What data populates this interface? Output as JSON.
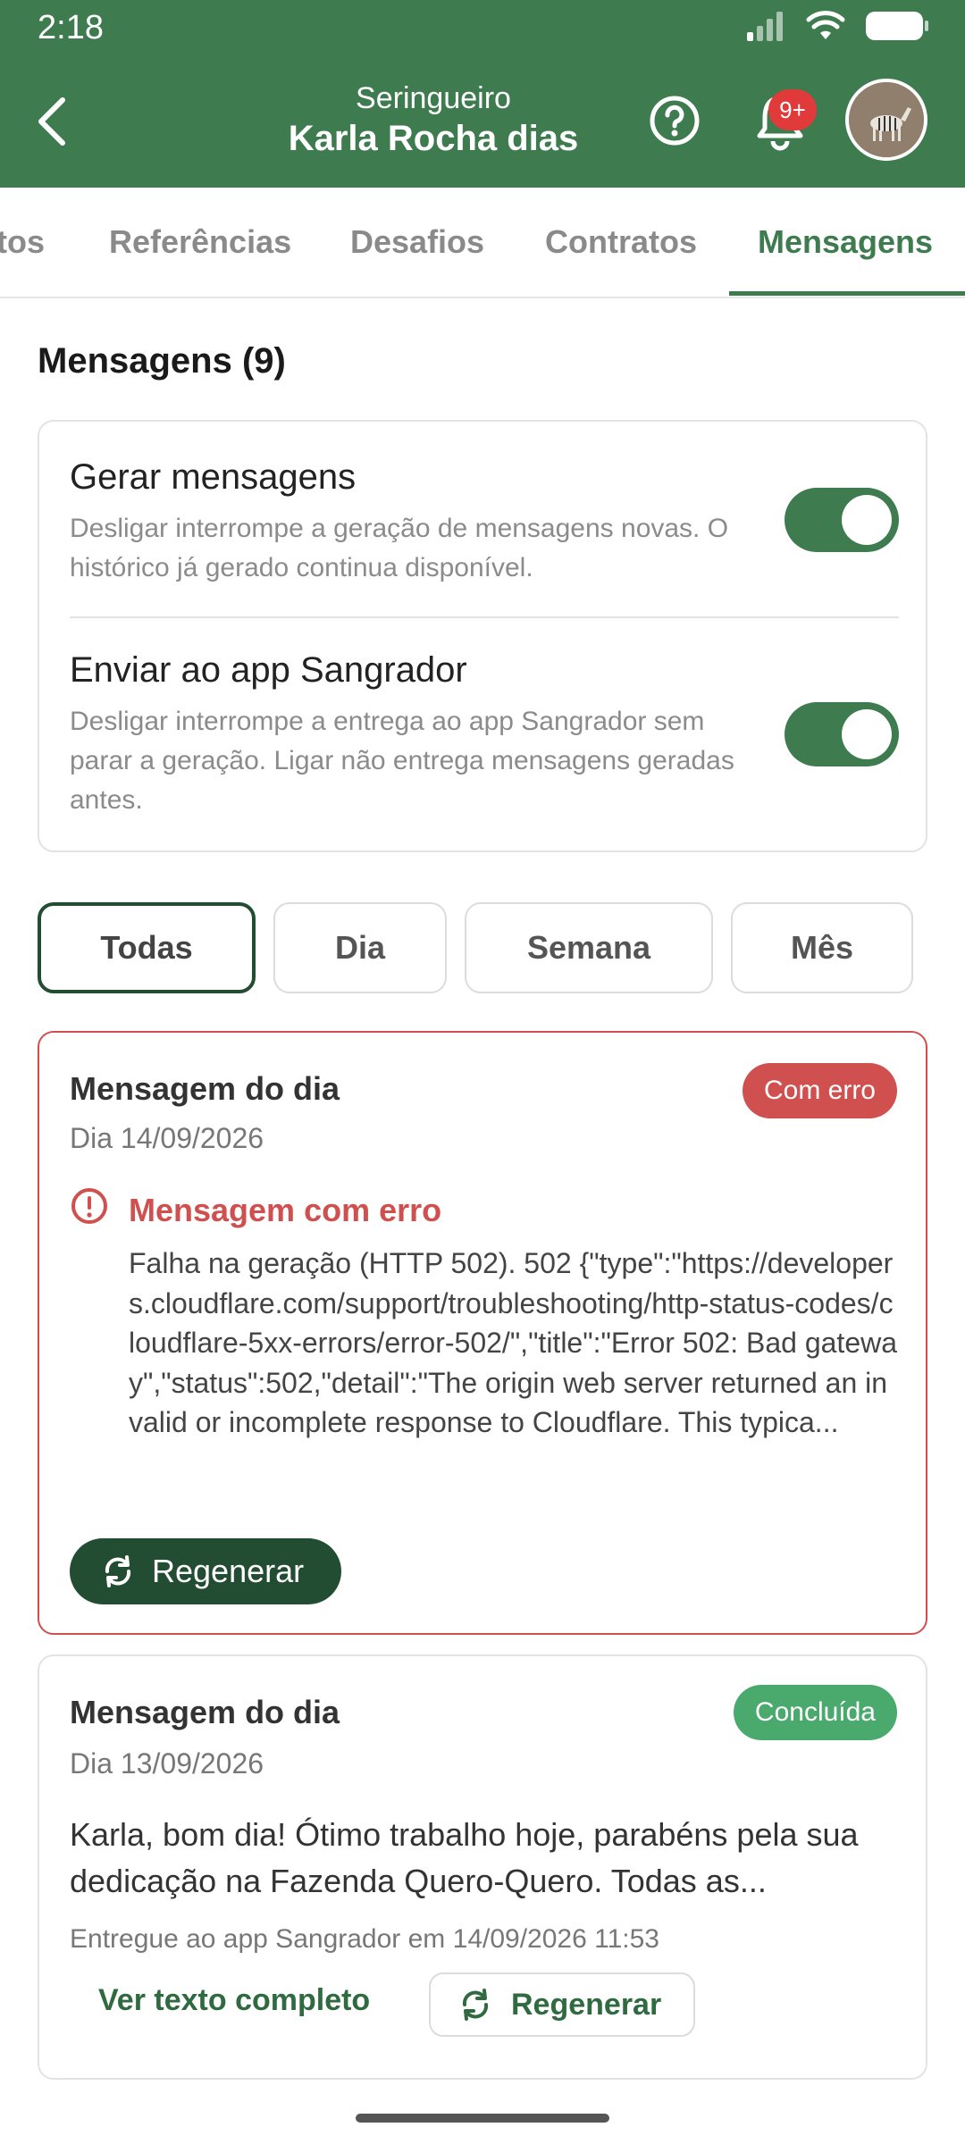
{
  "status_bar": {
    "time": "2:18"
  },
  "header": {
    "subtitle": "Seringueiro",
    "title": "Karla Rocha dias",
    "notification_badge": "9+"
  },
  "tabs": [
    {
      "label": "tos"
    },
    {
      "label": "Referências"
    },
    {
      "label": "Desafios"
    },
    {
      "label": "Contratos"
    },
    {
      "label": "Mensagens",
      "active": true
    }
  ],
  "section": {
    "title": "Mensagens (9)"
  },
  "settings": [
    {
      "title": "Gerar mensagens",
      "description": "Desligar interrompe a geração de mensagens novas. O histórico já gerado continua disponível.",
      "enabled": true
    },
    {
      "title": "Enviar ao app Sangrador",
      "description": "Desligar interrompe a entrega ao app Sangrador sem parar a geração. Ligar não entrega mensagens geradas antes.",
      "enabled": true
    }
  ],
  "filters": [
    {
      "label": "Todas",
      "active": true
    },
    {
      "label": "Dia"
    },
    {
      "label": "Semana"
    },
    {
      "label": "Mês"
    }
  ],
  "messages": [
    {
      "title": "Mensagem do dia",
      "date": "Dia 14/09/2026",
      "status": "Com erro",
      "error_heading": "Mensagem com erro",
      "error_body": "Falha na geração (HTTP 502). 502 {\"type\":\"https://developers.cloudflare.com/support/troubleshooting/http-status-codes/cloudflare-5xx-errors/error-502/\",\"title\":\"Error 502: Bad gateway\",\"status\":502,\"detail\":\"The origin web server returned an invalid or incomplete response to Cloudflare. This typica...",
      "regen_label": "Regenerar"
    },
    {
      "title": "Mensagem do dia",
      "date": "Dia 13/09/2026",
      "status": "Concluída",
      "body": "Karla, bom dia! Ótimo trabalho hoje, parabéns pela sua dedicação na Fazenda Quero-Quero. Todas as...",
      "delivered": "Entregue ao app Sangrador em 14/09/2026 11:53",
      "view_full_label": "Ver texto completo",
      "regen_label": "Regenerar"
    }
  ],
  "colors": {
    "brand_green": "#3e7b4f",
    "dark_green": "#234d33",
    "error_red": "#d05050",
    "success_green": "#4aa96c"
  }
}
